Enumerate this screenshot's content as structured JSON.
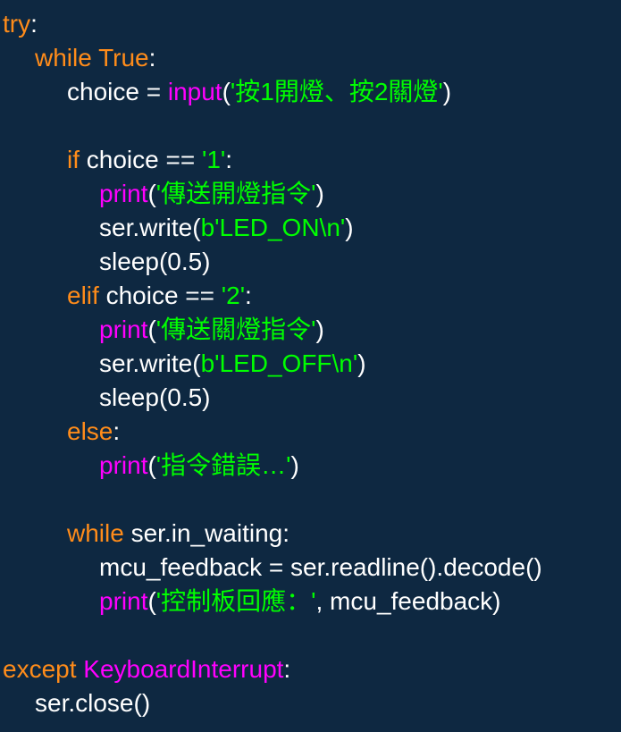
{
  "colors": {
    "background": "#0e2841",
    "default": "#ffffff",
    "keyword": "#ff8c1a",
    "builtin": "#ff00ff",
    "string": "#00ff00"
  },
  "lines": [
    {
      "indent": 0,
      "tokens": [
        {
          "t": "try",
          "c": "keyword"
        },
        {
          "t": ":",
          "c": "default"
        }
      ]
    },
    {
      "indent": 1,
      "tokens": [
        {
          "t": "while True",
          "c": "keyword"
        },
        {
          "t": ":",
          "c": "default"
        }
      ]
    },
    {
      "indent": 2,
      "tokens": [
        {
          "t": "choice = ",
          "c": "default"
        },
        {
          "t": "input",
          "c": "builtin"
        },
        {
          "t": "(",
          "c": "default"
        },
        {
          "t": "'按1開燈、按2關燈'",
          "c": "string"
        },
        {
          "t": ")",
          "c": "default"
        }
      ]
    },
    {
      "indent": 2,
      "tokens": []
    },
    {
      "indent": 2,
      "tokens": [
        {
          "t": "if",
          "c": "keyword"
        },
        {
          "t": " choice == ",
          "c": "default"
        },
        {
          "t": "'1'",
          "c": "string"
        },
        {
          "t": ":",
          "c": "default"
        }
      ]
    },
    {
      "indent": 3,
      "tokens": [
        {
          "t": "print",
          "c": "builtin"
        },
        {
          "t": "(",
          "c": "default"
        },
        {
          "t": "'傳送開燈指令'",
          "c": "string"
        },
        {
          "t": ")",
          "c": "default"
        }
      ]
    },
    {
      "indent": 3,
      "tokens": [
        {
          "t": "ser.write(",
          "c": "default"
        },
        {
          "t": "b'LED_ON\\n'",
          "c": "string"
        },
        {
          "t": ")",
          "c": "default"
        }
      ]
    },
    {
      "indent": 3,
      "tokens": [
        {
          "t": "sleep(0.5)",
          "c": "default"
        }
      ]
    },
    {
      "indent": 2,
      "tokens": [
        {
          "t": "elif",
          "c": "keyword"
        },
        {
          "t": " choice == ",
          "c": "default"
        },
        {
          "t": "'2'",
          "c": "string"
        },
        {
          "t": ":",
          "c": "default"
        }
      ]
    },
    {
      "indent": 3,
      "tokens": [
        {
          "t": "print",
          "c": "builtin"
        },
        {
          "t": "(",
          "c": "default"
        },
        {
          "t": "'傳送關燈指令'",
          "c": "string"
        },
        {
          "t": ")",
          "c": "default"
        }
      ]
    },
    {
      "indent": 3,
      "tokens": [
        {
          "t": "ser.write(",
          "c": "default"
        },
        {
          "t": "b'LED_OFF\\n'",
          "c": "string"
        },
        {
          "t": ")",
          "c": "default"
        }
      ]
    },
    {
      "indent": 3,
      "tokens": [
        {
          "t": "sleep(0.5)",
          "c": "default"
        }
      ]
    },
    {
      "indent": 2,
      "tokens": [
        {
          "t": "else",
          "c": "keyword"
        },
        {
          "t": ":",
          "c": "default"
        }
      ]
    },
    {
      "indent": 3,
      "tokens": [
        {
          "t": "print",
          "c": "builtin"
        },
        {
          "t": "(",
          "c": "default"
        },
        {
          "t": "'指令錯誤…'",
          "c": "string"
        },
        {
          "t": ")",
          "c": "default"
        }
      ]
    },
    {
      "indent": 3,
      "tokens": []
    },
    {
      "indent": 2,
      "tokens": [
        {
          "t": "while",
          "c": "keyword"
        },
        {
          "t": " ser.in_waiting:",
          "c": "default"
        }
      ]
    },
    {
      "indent": 3,
      "tokens": [
        {
          "t": "mcu_feedback = ser.readline().decode()",
          "c": "default"
        }
      ]
    },
    {
      "indent": 3,
      "tokens": [
        {
          "t": "print",
          "c": "builtin"
        },
        {
          "t": "(",
          "c": "default"
        },
        {
          "t": "'控制板回應：'",
          "c": "string"
        },
        {
          "t": ", mcu_feedback)",
          "c": "default"
        }
      ]
    },
    {
      "indent": 0,
      "tokens": []
    },
    {
      "indent": 0,
      "tokens": [
        {
          "t": "except",
          "c": "keyword"
        },
        {
          "t": " ",
          "c": "default"
        },
        {
          "t": "KeyboardInterrupt",
          "c": "builtin"
        },
        {
          "t": ":",
          "c": "default"
        }
      ]
    },
    {
      "indent": 1,
      "tokens": [
        {
          "t": "ser.close()",
          "c": "default"
        }
      ]
    }
  ]
}
